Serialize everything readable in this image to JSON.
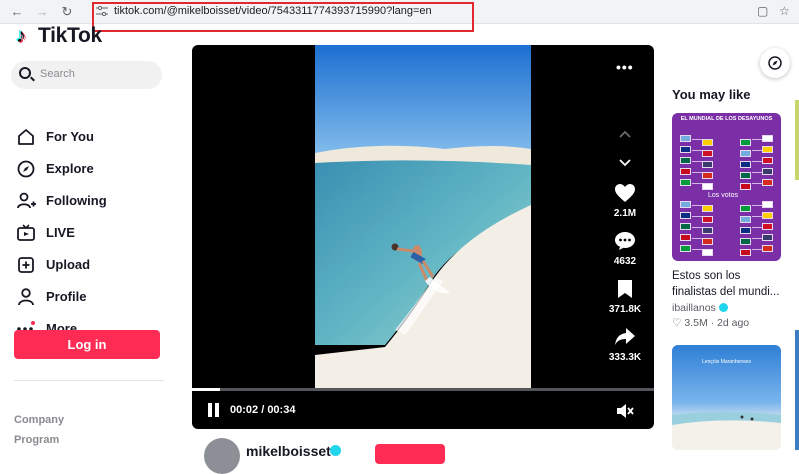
{
  "browser": {
    "url": "tiktok.com/@mikelboisset/video/7543311774393715990?lang=en"
  },
  "sidebar": {
    "logo_text": "TikTok",
    "search_placeholder": "Search",
    "nav": [
      {
        "label": "For You",
        "icon": "home-icon"
      },
      {
        "label": "Explore",
        "icon": "compass-icon"
      },
      {
        "label": "Following",
        "icon": "user-plus-icon"
      },
      {
        "label": "LIVE",
        "icon": "live-tv-icon"
      },
      {
        "label": "Upload",
        "icon": "plus-square-icon"
      },
      {
        "label": "Profile",
        "icon": "person-icon"
      },
      {
        "label": "More",
        "icon": "more-dots-icon"
      }
    ],
    "login_label": "Log in",
    "footer": [
      "Company",
      "Program"
    ]
  },
  "player": {
    "likes": "2.1M",
    "comments": "4632",
    "saves": "371.8K",
    "shares": "333.3K",
    "current_time": "00:02",
    "duration": "00:34",
    "progress_fraction": 0.06
  },
  "author": {
    "name": "mikelboisset"
  },
  "recommendations": {
    "heading": "You may like",
    "items": [
      {
        "thumb_title": "EL MUNDIAL DE LOS DESAYUNOS",
        "thumb_label": "Los votos",
        "title": "Estos son los finalistas del mundi...",
        "author": "ibaillanos",
        "likes": "3.5M",
        "age": "2d ago"
      },
      {
        "thumb_caption": "Lençóis Maranhenses"
      }
    ]
  },
  "colors": {
    "accent": "#fe2c55",
    "url_highlight": "#e0282f",
    "verified": "#20d5ec"
  }
}
